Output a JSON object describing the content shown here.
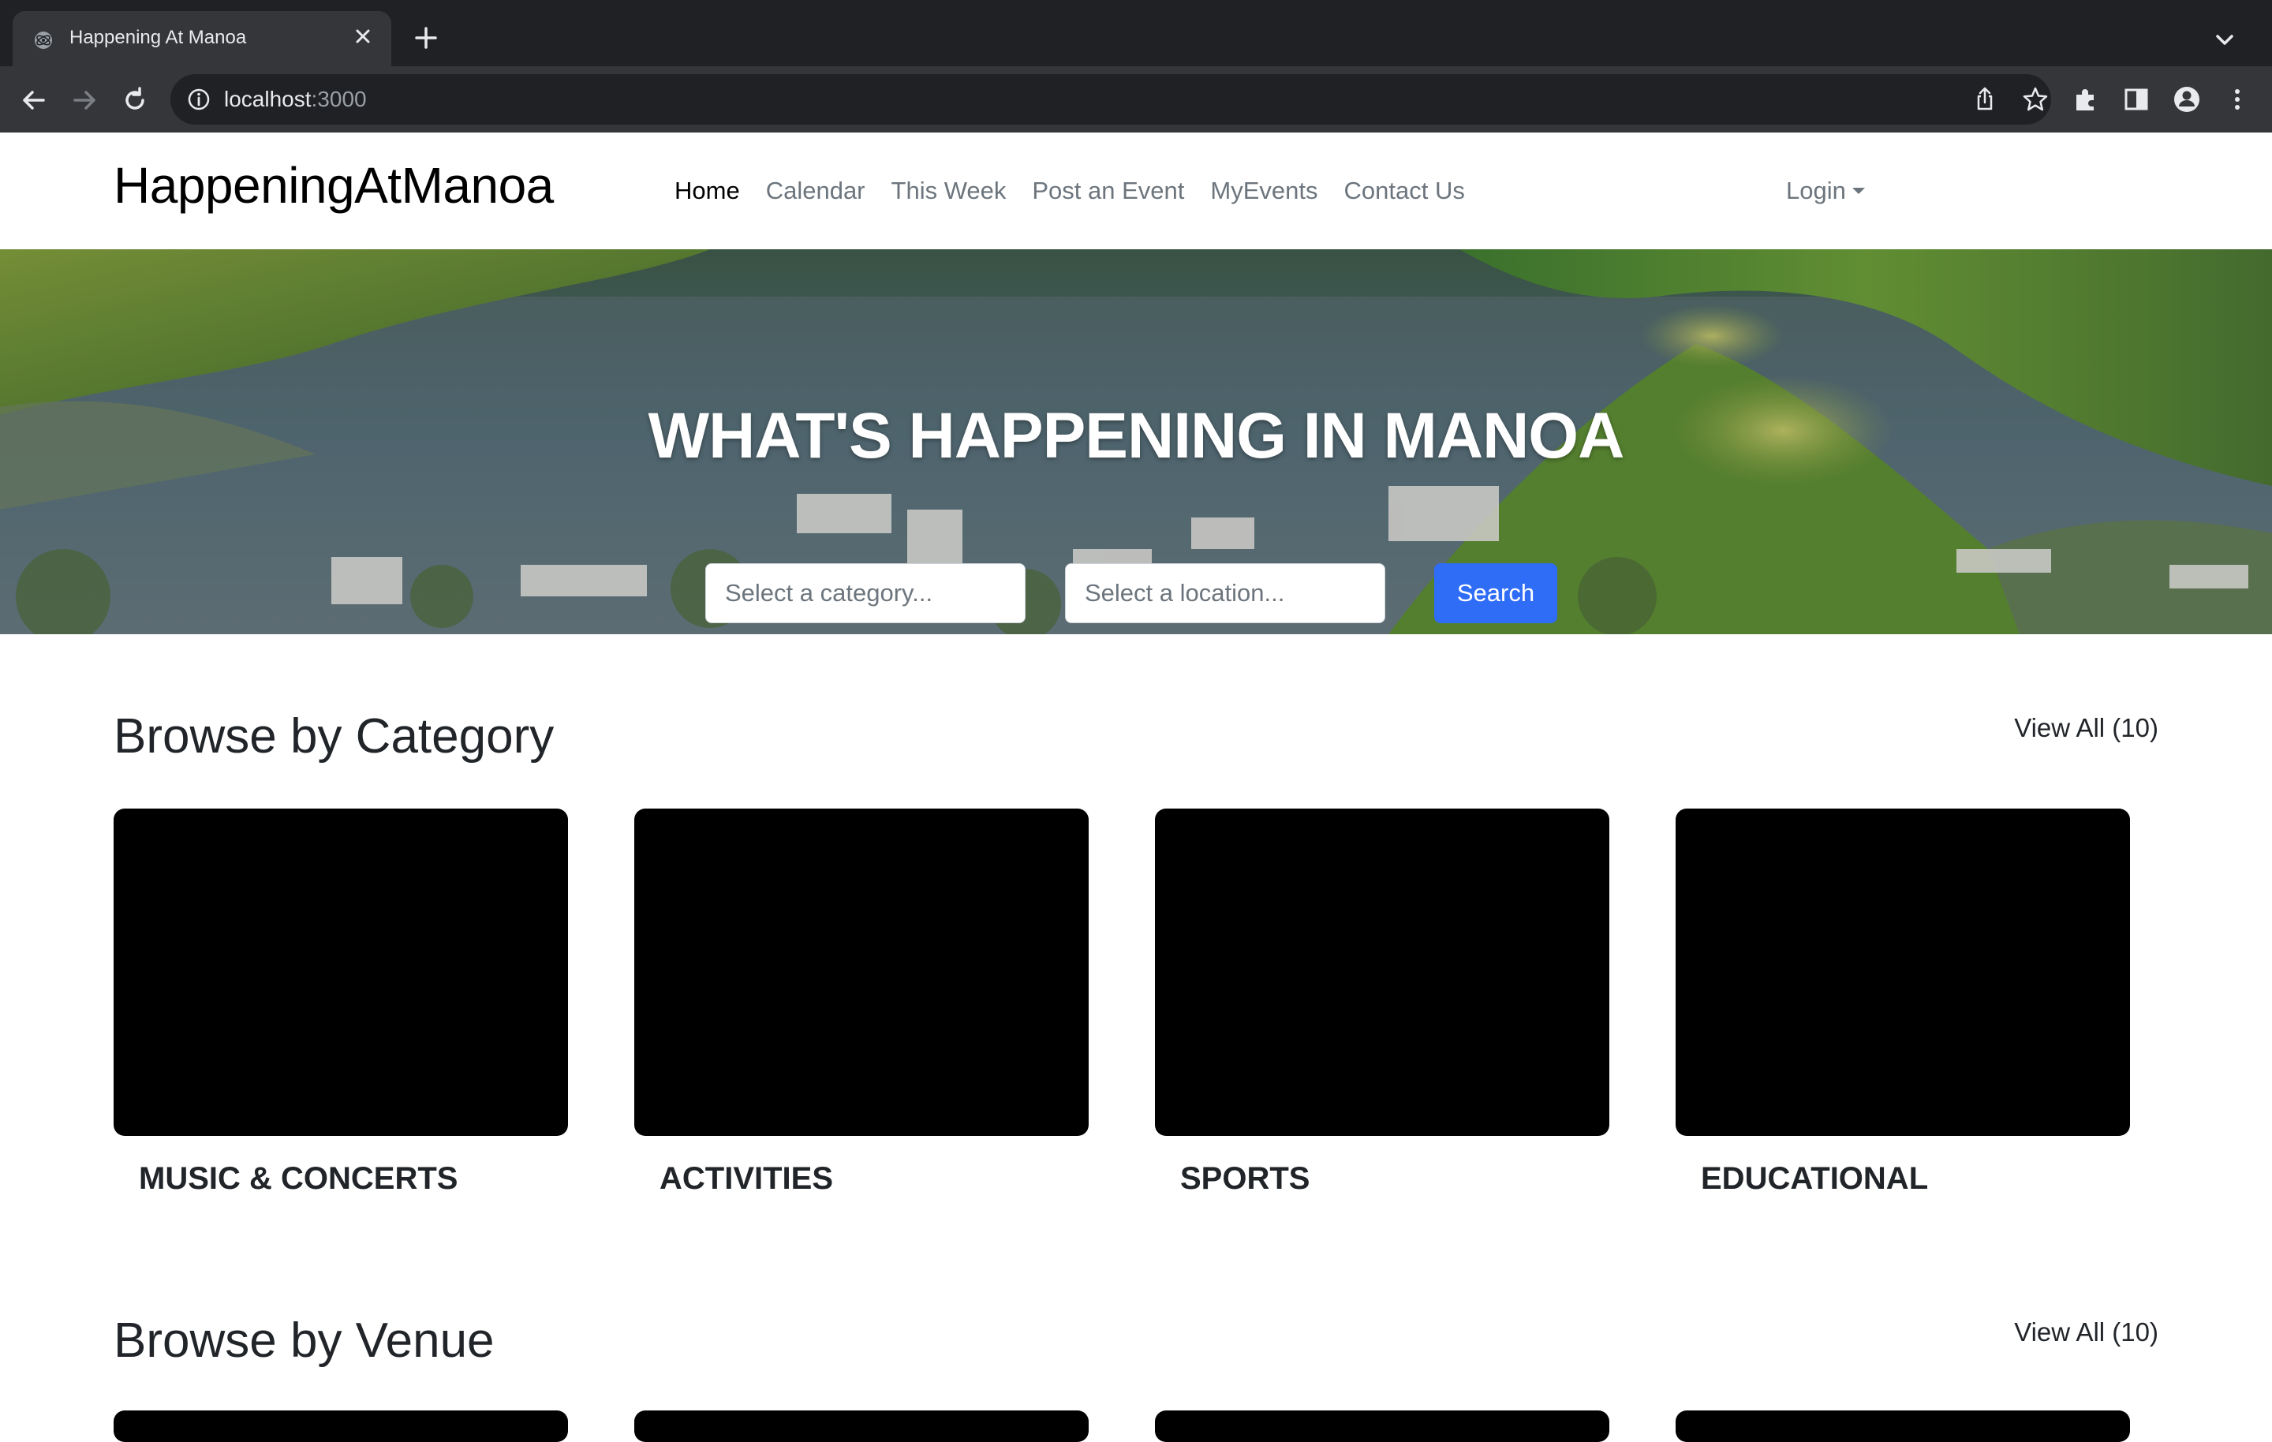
{
  "browser": {
    "tab_title": "Happening At Manoa",
    "url_host": "localhost",
    "url_port": ":3000"
  },
  "navbar": {
    "brand": "HappeningAtManoa",
    "links": [
      "Home",
      "Calendar",
      "This Week",
      "Post an Event",
      "MyEvents",
      "Contact Us"
    ],
    "active": "Home",
    "login_label": "Login"
  },
  "hero": {
    "title": "WHAT'S HAPPENING IN MANOA",
    "category_placeholder": "Select a category...",
    "location_placeholder": "Select a location...",
    "search_label": "Search"
  },
  "categories": {
    "heading": "Browse by Category",
    "view_all": "View All (10)",
    "items": [
      "MUSIC & CONCERTS",
      "ACTIVITIES",
      "SPORTS",
      "EDUCATIONAL"
    ]
  },
  "venues": {
    "heading": "Browse by Venue",
    "view_all": "View All (10)"
  },
  "colors": {
    "primary_button": "#2f6df6",
    "tab_strip": "#202124",
    "toolbar": "#35363a"
  }
}
